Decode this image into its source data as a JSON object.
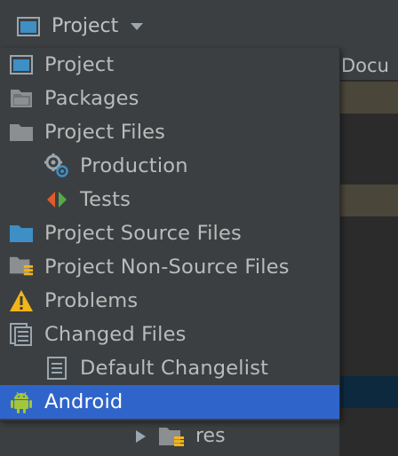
{
  "header": {
    "title": "Project",
    "icon": "project-window-icon"
  },
  "editor": {
    "tab_label": "Docu"
  },
  "background_tree": {
    "item_label": "res",
    "item_icon": "folder-res-icon"
  },
  "colors": {
    "background": "#3c3f41",
    "selection": "#2f65ca",
    "text": "#bbbbbb",
    "folder": "#8b8f92",
    "source_folder": "#3d8fc6",
    "android_green": "#a4c639",
    "warning_yellow": "#f2b518"
  },
  "menu": {
    "selected": "Android",
    "items": [
      {
        "label": "Project",
        "icon": "project-window-icon"
      },
      {
        "label": "Packages",
        "icon": "packages-icon"
      },
      {
        "label": "Project Files",
        "icon": "folder-icon"
      },
      {
        "label": "Production",
        "icon": "production-gear-icon"
      },
      {
        "label": "Tests",
        "icon": "tests-arrows-icon"
      },
      {
        "label": "Project Source Files",
        "icon": "source-folder-icon"
      },
      {
        "label": "Project Non-Source Files",
        "icon": "non-source-folder-icon"
      },
      {
        "label": "Problems",
        "icon": "warning-icon"
      },
      {
        "label": "Changed Files",
        "icon": "changed-files-icon"
      },
      {
        "label": "Default Changelist",
        "icon": "changelist-icon"
      },
      {
        "label": "Android",
        "icon": "android-icon"
      }
    ]
  }
}
